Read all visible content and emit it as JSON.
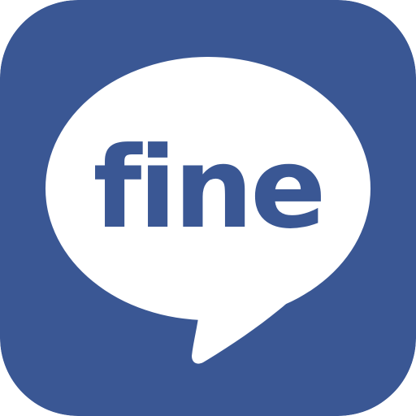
{
  "app_icon": {
    "wordmark": "fine",
    "colors": {
      "background": "#3a5794",
      "bubble": "#ffffff",
      "wordmark": "#3a5794"
    },
    "icons": {
      "tile": "app-icon-tile",
      "bubble": "speech-bubble-icon"
    }
  }
}
